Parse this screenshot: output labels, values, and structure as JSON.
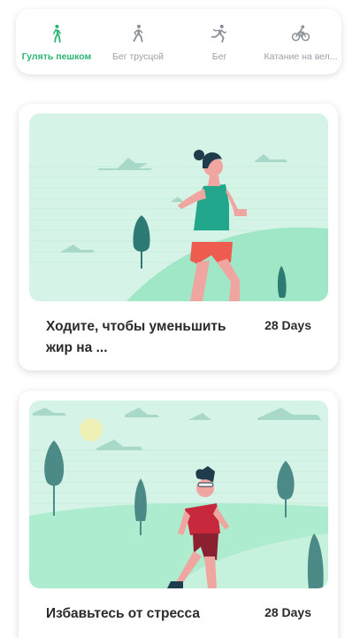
{
  "tabs": [
    {
      "label": "Гулять пешком",
      "icon": "walk-icon",
      "active": true
    },
    {
      "label": "Бег трусцой",
      "icon": "jog-icon",
      "active": false
    },
    {
      "label": "Бег",
      "icon": "run-icon",
      "active": false
    },
    {
      "label": "Катание на вел...",
      "icon": "bike-icon",
      "active": false
    }
  ],
  "cards": [
    {
      "title": "Ходите, чтобы уменьшить жир на ...",
      "days": "28 Days"
    },
    {
      "title": "Избавьтесь от стресса",
      "days": "28 Days"
    }
  ],
  "colors": {
    "accent": "#2bb673",
    "inactive": "#9aa0a6",
    "mint": "#d5f3e6"
  }
}
